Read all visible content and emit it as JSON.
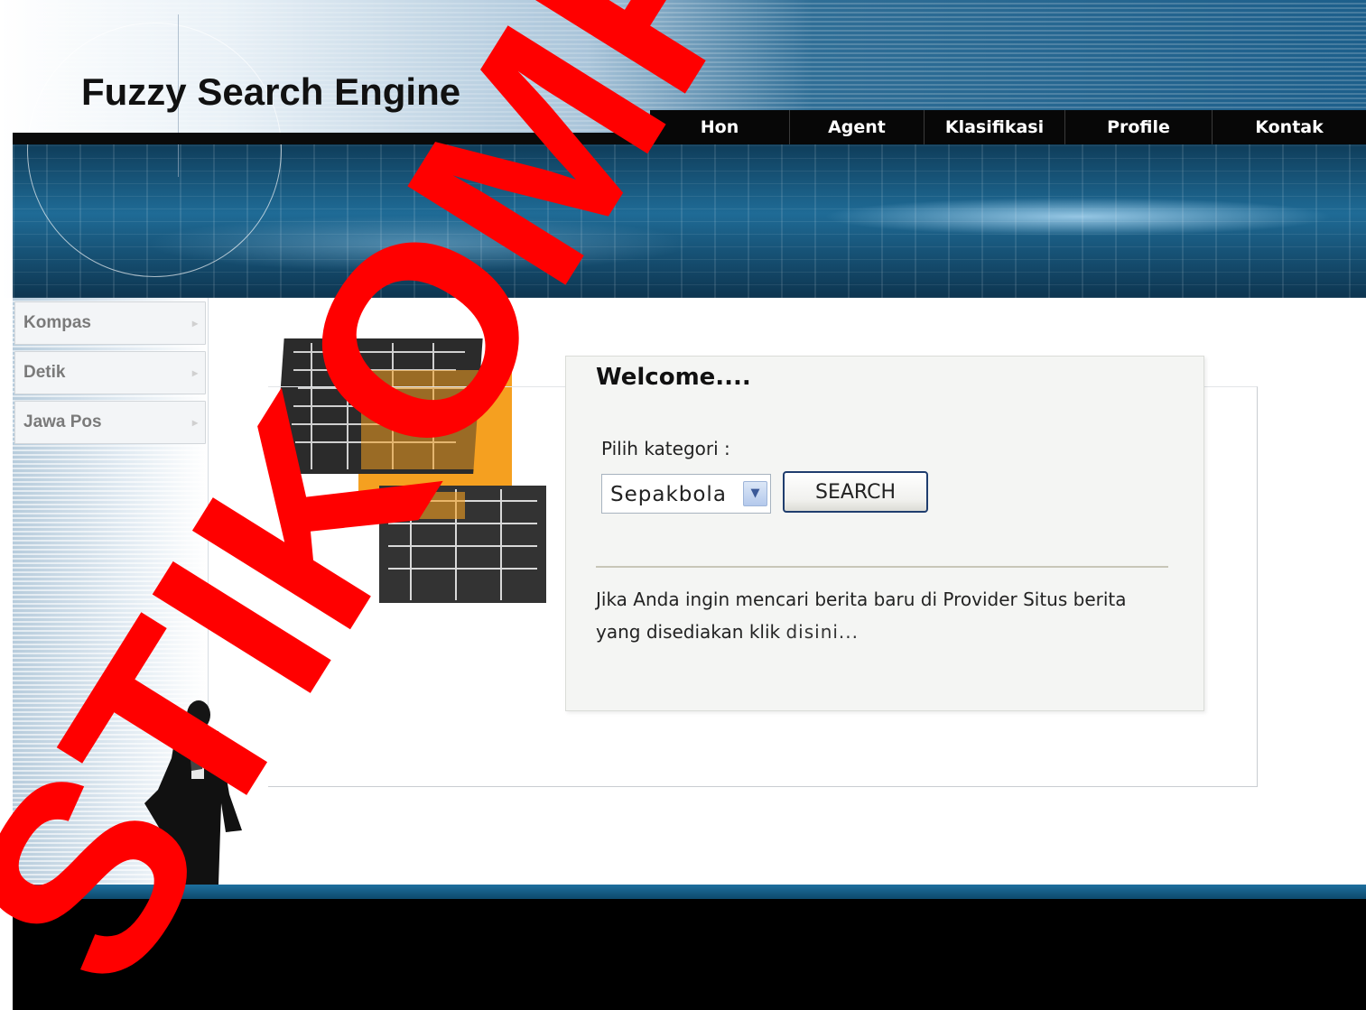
{
  "header": {
    "title": "Fuzzy Search Engine"
  },
  "nav": {
    "items": [
      {
        "label": "Hon"
      },
      {
        "label": "Agent"
      },
      {
        "label": "Klasifikasi"
      },
      {
        "label": "Profile"
      },
      {
        "label": "Kontak"
      }
    ]
  },
  "sidebar": {
    "items": [
      {
        "label": "Kompas"
      },
      {
        "label": "Detik"
      },
      {
        "label": "Jawa Pos"
      }
    ]
  },
  "main": {
    "welcome_title": "Welcome....",
    "category_label": "Pilih kategori :",
    "category_selected": "Sepakbola",
    "search_label": "SEARCH",
    "info_text": "Jika Anda ingin mencari berita baru di Provider Situs berita yang disediakan klik",
    "info_link": "disini..."
  },
  "watermark": {
    "text": "STIKOMP SU",
    "color": "#ff0000"
  },
  "colors": {
    "banner": "#1d5f8b",
    "nav_bg": "#070707",
    "accent_orange": "#f5a020"
  },
  "icons": {
    "dropdown": "chevron-down-icon",
    "sidebar_arrow": "arrow-right-icon"
  }
}
